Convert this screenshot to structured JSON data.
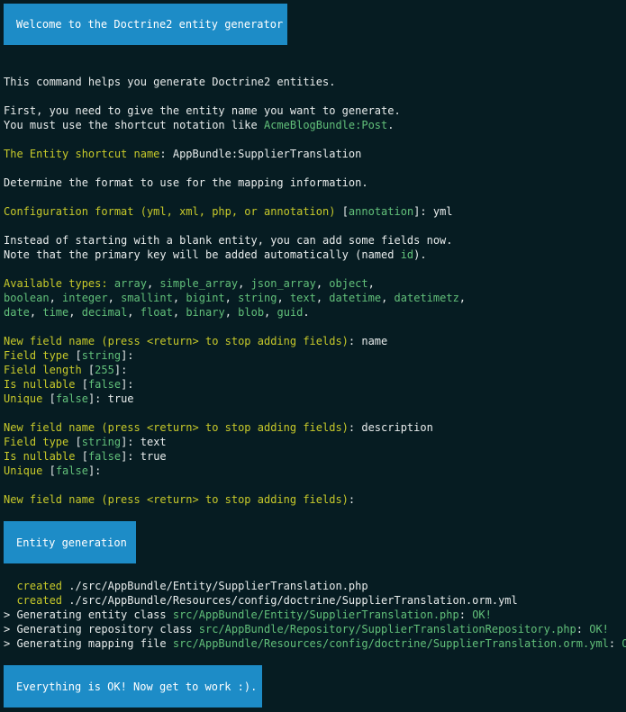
{
  "banners": {
    "welcome": "Welcome to the Doctrine2 entity generator",
    "entity_generation": "Entity generation",
    "success": "Everything is OK! Now get to work :)."
  },
  "intro": {
    "line1": "This command helps you generate Doctrine2 entities.",
    "line2": "First, you need to give the entity name you want to generate.",
    "line3_prefix": "You must use the shortcut notation like ",
    "line3_example": "AcmeBlogBundle:Post",
    "line3_suffix": "."
  },
  "entity_prompt": {
    "label": "The Entity shortcut name",
    "sep": ": ",
    "value": "AppBundle:SupplierTranslation"
  },
  "format_info": "Determine the format to use for the mapping information.",
  "format_prompt": {
    "label": "Configuration format (yml, xml, php, or annotation)",
    "default_open": " [",
    "default": "annotation",
    "default_close": "]: ",
    "value": "yml"
  },
  "fields_info": {
    "line1": "Instead of starting with a blank entity, you can add some fields now.",
    "line2_prefix": "Note that the primary key will be added automatically (named ",
    "line2_id": "id",
    "line2_suffix": ")."
  },
  "types": {
    "label": "Available types:",
    "row1": [
      "array",
      "simple_array",
      "json_array",
      "object"
    ],
    "row2": [
      "boolean",
      "integer",
      "smallint",
      "bigint",
      "string",
      "text",
      "datetime",
      "datetimetz"
    ],
    "row3": [
      "date",
      "time",
      "decimal",
      "float",
      "binary",
      "blob",
      "guid"
    ],
    "sep": ", ",
    "row_end": ",",
    "final_end": "."
  },
  "prompts": {
    "new_field": "New field name (press <return> to stop adding fields)",
    "field_type": "Field type",
    "field_length": "Field length",
    "is_nullable": "Is nullable",
    "unique": "Unique",
    "colon": ":",
    "colon_space": ": ",
    "open": " [",
    "close": "]",
    "close_colon": "]:",
    "close_colon_space": "]: "
  },
  "field1": {
    "name": "name",
    "type_default": "string",
    "length_default": "255",
    "nullable_default": "false",
    "unique_default": "false",
    "unique_value": "true"
  },
  "field2": {
    "name": "description",
    "type_default": "string",
    "type_value": "text",
    "nullable_default": "false",
    "nullable_value": "true",
    "unique_default": "false"
  },
  "output": {
    "created_label": "  created",
    "created1": " ./src/AppBundle/Entity/SupplierTranslation.php",
    "created2": " ./src/AppBundle/Resources/config/doctrine/SupplierTranslation.orm.yml",
    "gen1_label": "> Generating entity class ",
    "gen1_path": "src/AppBundle/Entity/SupplierTranslation.php",
    "gen2_label": "> Generating repository class ",
    "gen2_path": "src/AppBundle/Repository/SupplierTranslationRepository.php",
    "gen3_label": "> Generating mapping file ",
    "gen3_path": "src/AppBundle/Resources/config/doctrine/SupplierTranslation.orm.yml",
    "ok_sep": ": ",
    "ok": "OK!"
  },
  "colors": {
    "background": "#061c22",
    "banner": "#1d8cc7",
    "prompt_yellow": "#c7c92a",
    "value_green": "#62c07a",
    "text": "#e8ecec"
  }
}
